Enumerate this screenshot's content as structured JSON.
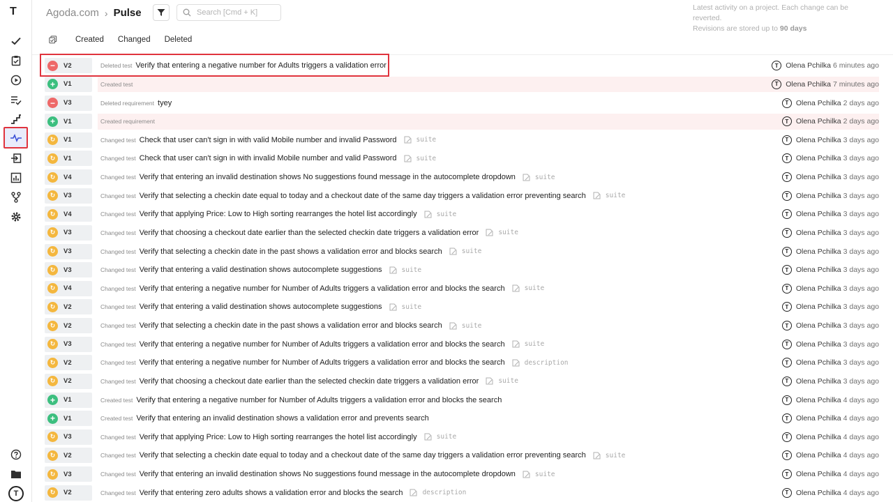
{
  "app": {
    "logo": "T",
    "avatar_initial": "T"
  },
  "sidebar": {
    "items": [
      {
        "name": "check-icon"
      },
      {
        "name": "clipboard-check-icon"
      },
      {
        "name": "play-circle-icon"
      },
      {
        "name": "list-check-icon"
      },
      {
        "name": "steps-icon"
      },
      {
        "name": "pulse-icon",
        "active": true
      },
      {
        "name": "import-icon"
      },
      {
        "name": "chart-icon"
      },
      {
        "name": "branch-icon"
      },
      {
        "name": "gear-icon"
      }
    ],
    "bottom": [
      {
        "name": "help-icon"
      },
      {
        "name": "folder-icon"
      }
    ]
  },
  "header": {
    "org": "Agoda.com",
    "separator": "›",
    "page": "Pulse",
    "search_placeholder": "Search [Cmd + K]",
    "info_line1": "Latest activity on a project. Each change can be reverted.",
    "info_line2_prefix": "Revisions are stored up to",
    "info_line2_value": "90 days"
  },
  "tabs": [
    "Created",
    "Changed",
    "Deleted"
  ],
  "colors": {
    "deleted": "#ee6969",
    "created": "#3cbf7f",
    "changed": "#f4b73e",
    "highlight": "#e0333d",
    "pink_row": "#fdf0f0"
  },
  "rows": [
    {
      "status": "deleted",
      "version": "V2",
      "action": "Deleted test",
      "title": "Verify that entering a negative number for Adults triggers a validation error",
      "field": "",
      "user": "Olena Pchilka",
      "time": "6 minutes ago",
      "pink": false
    },
    {
      "status": "created",
      "version": "V1",
      "action": "Created test",
      "title": "",
      "field": "",
      "user": "Olena Pchilka",
      "time": "7 minutes ago",
      "pink": true
    },
    {
      "status": "deleted",
      "version": "V3",
      "action": "Deleted requirement",
      "title": "tyey",
      "field": "",
      "user": "Olena Pchilka",
      "time": "2 days ago",
      "pink": false
    },
    {
      "status": "created",
      "version": "V1",
      "action": "Created requirement",
      "title": "",
      "field": "",
      "user": "Olena Pchilka",
      "time": "2 days ago",
      "pink": true
    },
    {
      "status": "changed",
      "version": "V1",
      "action": "Changed test",
      "title": "Check that user can't sign in with valid Mobile number and invalid Password",
      "field": "suite",
      "user": "Olena Pchilka",
      "time": "3 days ago",
      "pink": false
    },
    {
      "status": "changed",
      "version": "V1",
      "action": "Changed test",
      "title": "Check that user can't sign in with invalid Mobile number and valid Password",
      "field": "suite",
      "user": "Olena Pchilka",
      "time": "3 days ago",
      "pink": false
    },
    {
      "status": "changed",
      "version": "V4",
      "action": "Changed test",
      "title": "Verify that entering an invalid destination shows No suggestions found message in the autocomplete dropdown",
      "field": "suite",
      "user": "Olena Pchilka",
      "time": "3 days ago",
      "pink": false
    },
    {
      "status": "changed",
      "version": "V3",
      "action": "Changed test",
      "title": "Verify that selecting a checkin date equal to today and a checkout date of the same day triggers a validation error preventing search",
      "field": "suite",
      "user": "Olena Pchilka",
      "time": "3 days ago",
      "pink": false
    },
    {
      "status": "changed",
      "version": "V4",
      "action": "Changed test",
      "title": "Verify that applying Price: Low to High sorting rearranges the hotel list accordingly",
      "field": "suite",
      "user": "Olena Pchilka",
      "time": "3 days ago",
      "pink": false
    },
    {
      "status": "changed",
      "version": "V3",
      "action": "Changed test",
      "title": "Verify that choosing a checkout date earlier than the selected checkin date triggers a validation error",
      "field": "suite",
      "user": "Olena Pchilka",
      "time": "3 days ago",
      "pink": false
    },
    {
      "status": "changed",
      "version": "V3",
      "action": "Changed test",
      "title": "Verify that selecting a checkin date in the past shows a validation error and blocks search",
      "field": "suite",
      "user": "Olena Pchilka",
      "time": "3 days ago",
      "pink": false
    },
    {
      "status": "changed",
      "version": "V3",
      "action": "Changed test",
      "title": "Verify that entering a valid destination shows autocomplete suggestions",
      "field": "suite",
      "user": "Olena Pchilka",
      "time": "3 days ago",
      "pink": false
    },
    {
      "status": "changed",
      "version": "V4",
      "action": "Changed test",
      "title": "Verify that entering a negative number for Number of Adults triggers a validation error and blocks the search",
      "field": "suite",
      "user": "Olena Pchilka",
      "time": "3 days ago",
      "pink": false
    },
    {
      "status": "changed",
      "version": "V2",
      "action": "Changed test",
      "title": "Verify that entering a valid destination shows autocomplete suggestions",
      "field": "suite",
      "user": "Olena Pchilka",
      "time": "3 days ago",
      "pink": false
    },
    {
      "status": "changed",
      "version": "V2",
      "action": "Changed test",
      "title": "Verify that selecting a checkin date in the past shows a validation error and blocks search",
      "field": "suite",
      "user": "Olena Pchilka",
      "time": "3 days ago",
      "pink": false
    },
    {
      "status": "changed",
      "version": "V3",
      "action": "Changed test",
      "title": "Verify that entering a negative number for Number of Adults triggers a validation error and blocks the search",
      "field": "suite",
      "user": "Olena Pchilka",
      "time": "3 days ago",
      "pink": false
    },
    {
      "status": "changed",
      "version": "V2",
      "action": "Changed test",
      "title": "Verify that entering a negative number for Number of Adults triggers a validation error and blocks the search",
      "field": "description",
      "user": "Olena Pchilka",
      "time": "3 days ago",
      "pink": false
    },
    {
      "status": "changed",
      "version": "V2",
      "action": "Changed test",
      "title": "Verify that choosing a checkout date earlier than the selected checkin date triggers a validation error",
      "field": "suite",
      "user": "Olena Pchilka",
      "time": "3 days ago",
      "pink": false
    },
    {
      "status": "created",
      "version": "V1",
      "action": "Created test",
      "title": "Verify that entering a negative number for Number of Adults triggers a validation error and blocks the search",
      "field": "",
      "user": "Olena Pchilka",
      "time": "4 days ago",
      "pink": false
    },
    {
      "status": "created",
      "version": "V1",
      "action": "Created test",
      "title": "Verify that entering an invalid destination shows a validation error and prevents search",
      "field": "",
      "user": "Olena Pchilka",
      "time": "4 days ago",
      "pink": false
    },
    {
      "status": "changed",
      "version": "V3",
      "action": "Changed test",
      "title": "Verify that applying Price: Low to High sorting rearranges the hotel list accordingly",
      "field": "suite",
      "user": "Olena Pchilka",
      "time": "4 days ago",
      "pink": false
    },
    {
      "status": "changed",
      "version": "V2",
      "action": "Changed test",
      "title": "Verify that selecting a checkin date equal to today and a checkout date of the same day triggers a validation error preventing search",
      "field": "suite",
      "user": "Olena Pchilka",
      "time": "4 days ago",
      "pink": false
    },
    {
      "status": "changed",
      "version": "V3",
      "action": "Changed test",
      "title": "Verify that entering an invalid destination shows No suggestions found message in the autocomplete dropdown",
      "field": "suite",
      "user": "Olena Pchilka",
      "time": "4 days ago",
      "pink": false
    },
    {
      "status": "changed",
      "version": "V2",
      "action": "Changed test",
      "title": "Verify that entering zero adults shows a validation error and blocks the search",
      "field": "description",
      "user": "Olena Pchilka",
      "time": "4 days ago",
      "pink": false
    }
  ]
}
